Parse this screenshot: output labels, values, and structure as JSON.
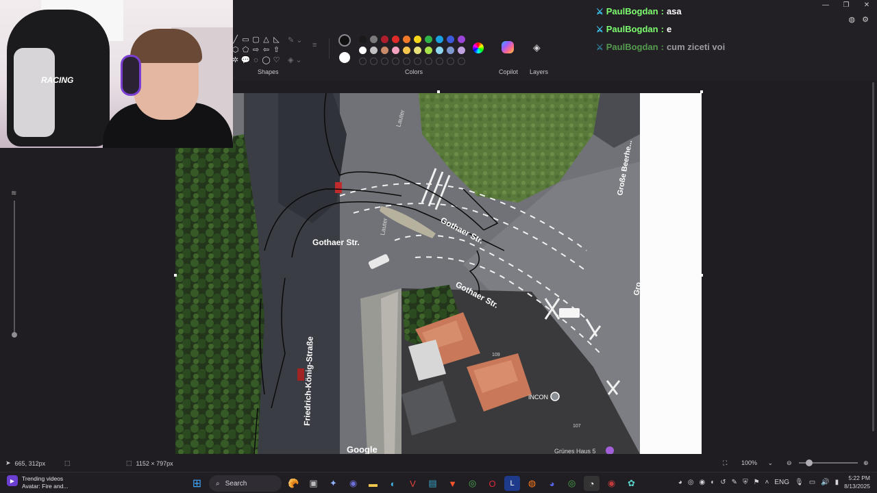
{
  "window": {
    "minimize_icon": "minimize-icon",
    "restore_icon": "restore-icon",
    "close_icon": "close-icon"
  },
  "ribbon": {
    "shapes_label": "Shapes",
    "colors_label": "Colors",
    "copilot_label": "Copilot",
    "layers_label": "Layers",
    "palette": [
      "#1a1a1a",
      "#7a7a7a",
      "#b01e2e",
      "#e02b2b",
      "#f07a2a",
      "#f7d61a",
      "#2fb34a",
      "#1aa0e0",
      "#3b5bdc",
      "#9b45d6",
      "#ffffff",
      "#c2c2c2",
      "#c98b6a",
      "#f3a3c0",
      "#f7c64e",
      "#e9e27a",
      "#a8e24a",
      "#8fd6f0",
      "#7f98d0",
      "#c2a3e2"
    ]
  },
  "chat": [
    {
      "user": "PaulBogdan",
      "text": "asa"
    },
    {
      "user": "PaulBogdan",
      "text": "e"
    },
    {
      "user": "PaulBogdan",
      "text": "cum ziceti voi"
    }
  ],
  "webcam": {
    "chair_brand": "RACING"
  },
  "map": {
    "labels": {
      "gothaer_1": "Gothaer Str.",
      "gothaer_2": "Gothaer Str.",
      "gothaer_3": "Gothaer Str.",
      "friedrich": "Friedrich-König-Straße",
      "lauter_1": "Lauter",
      "lauter_2": "Lauter",
      "grosse": "Große Beerhe...",
      "gro": "Gro",
      "incon": "INCON",
      "gruenes": "Grünes Haus 5",
      "google": "Google",
      "n109": "109",
      "n107": "107"
    }
  },
  "status": {
    "cursor_pos": "665, 312px",
    "canvas_size": "1152 × 797px",
    "zoom": "100%"
  },
  "taskbar": {
    "news_title": "Trending videos",
    "news_sub": "Avatar: Fire and...",
    "search_placeholder": "Search",
    "lang": "ENG",
    "time": "5:22 PM",
    "date": "8/13/2025"
  }
}
